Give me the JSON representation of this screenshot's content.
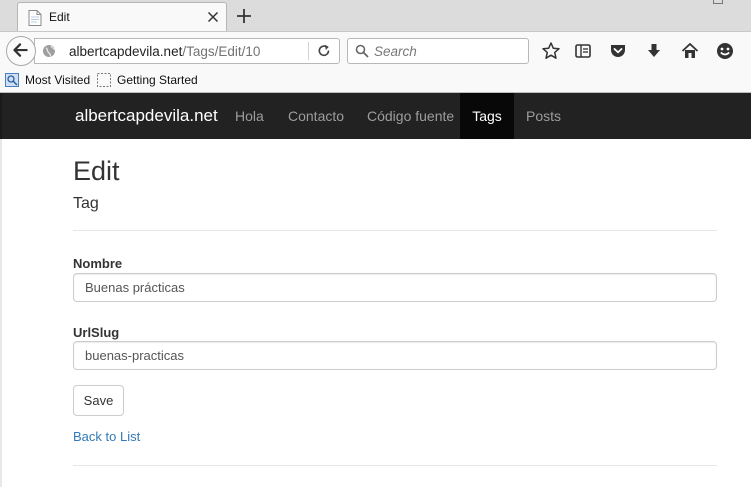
{
  "browser": {
    "tab": {
      "title": "Edit"
    },
    "url": {
      "host": "albertcapdevila.net",
      "path": "/Tags/Edit/10"
    },
    "search": {
      "placeholder": "Search"
    },
    "bookmarks": [
      {
        "label": "Most Visited",
        "icon": "most-visited-icon"
      },
      {
        "label": "Getting Started",
        "icon": "page-icon"
      }
    ],
    "toolbar_icons": [
      "star-icon",
      "reading-list-icon",
      "pocket-icon",
      "download-icon",
      "home-icon",
      "smiley-icon"
    ]
  },
  "site": {
    "brand": "albertcapdevila.net",
    "nav": [
      {
        "label": "Hola",
        "active": false
      },
      {
        "label": "Contacto",
        "active": false
      },
      {
        "label": "Código fuente",
        "active": false
      },
      {
        "label": "Tags",
        "active": true
      },
      {
        "label": "Posts",
        "active": false
      }
    ],
    "colors": {
      "navbar": "#222222",
      "active": "#080808",
      "link": "#337ab7"
    }
  },
  "page": {
    "title": "Edit",
    "subtitle": "Tag",
    "form": {
      "nombre": {
        "label": "Nombre",
        "value": "Buenas prácticas"
      },
      "urlslug": {
        "label": "UrlSlug",
        "value": "buenas-practicas"
      },
      "save_label": "Save"
    },
    "back_link": "Back to List"
  }
}
